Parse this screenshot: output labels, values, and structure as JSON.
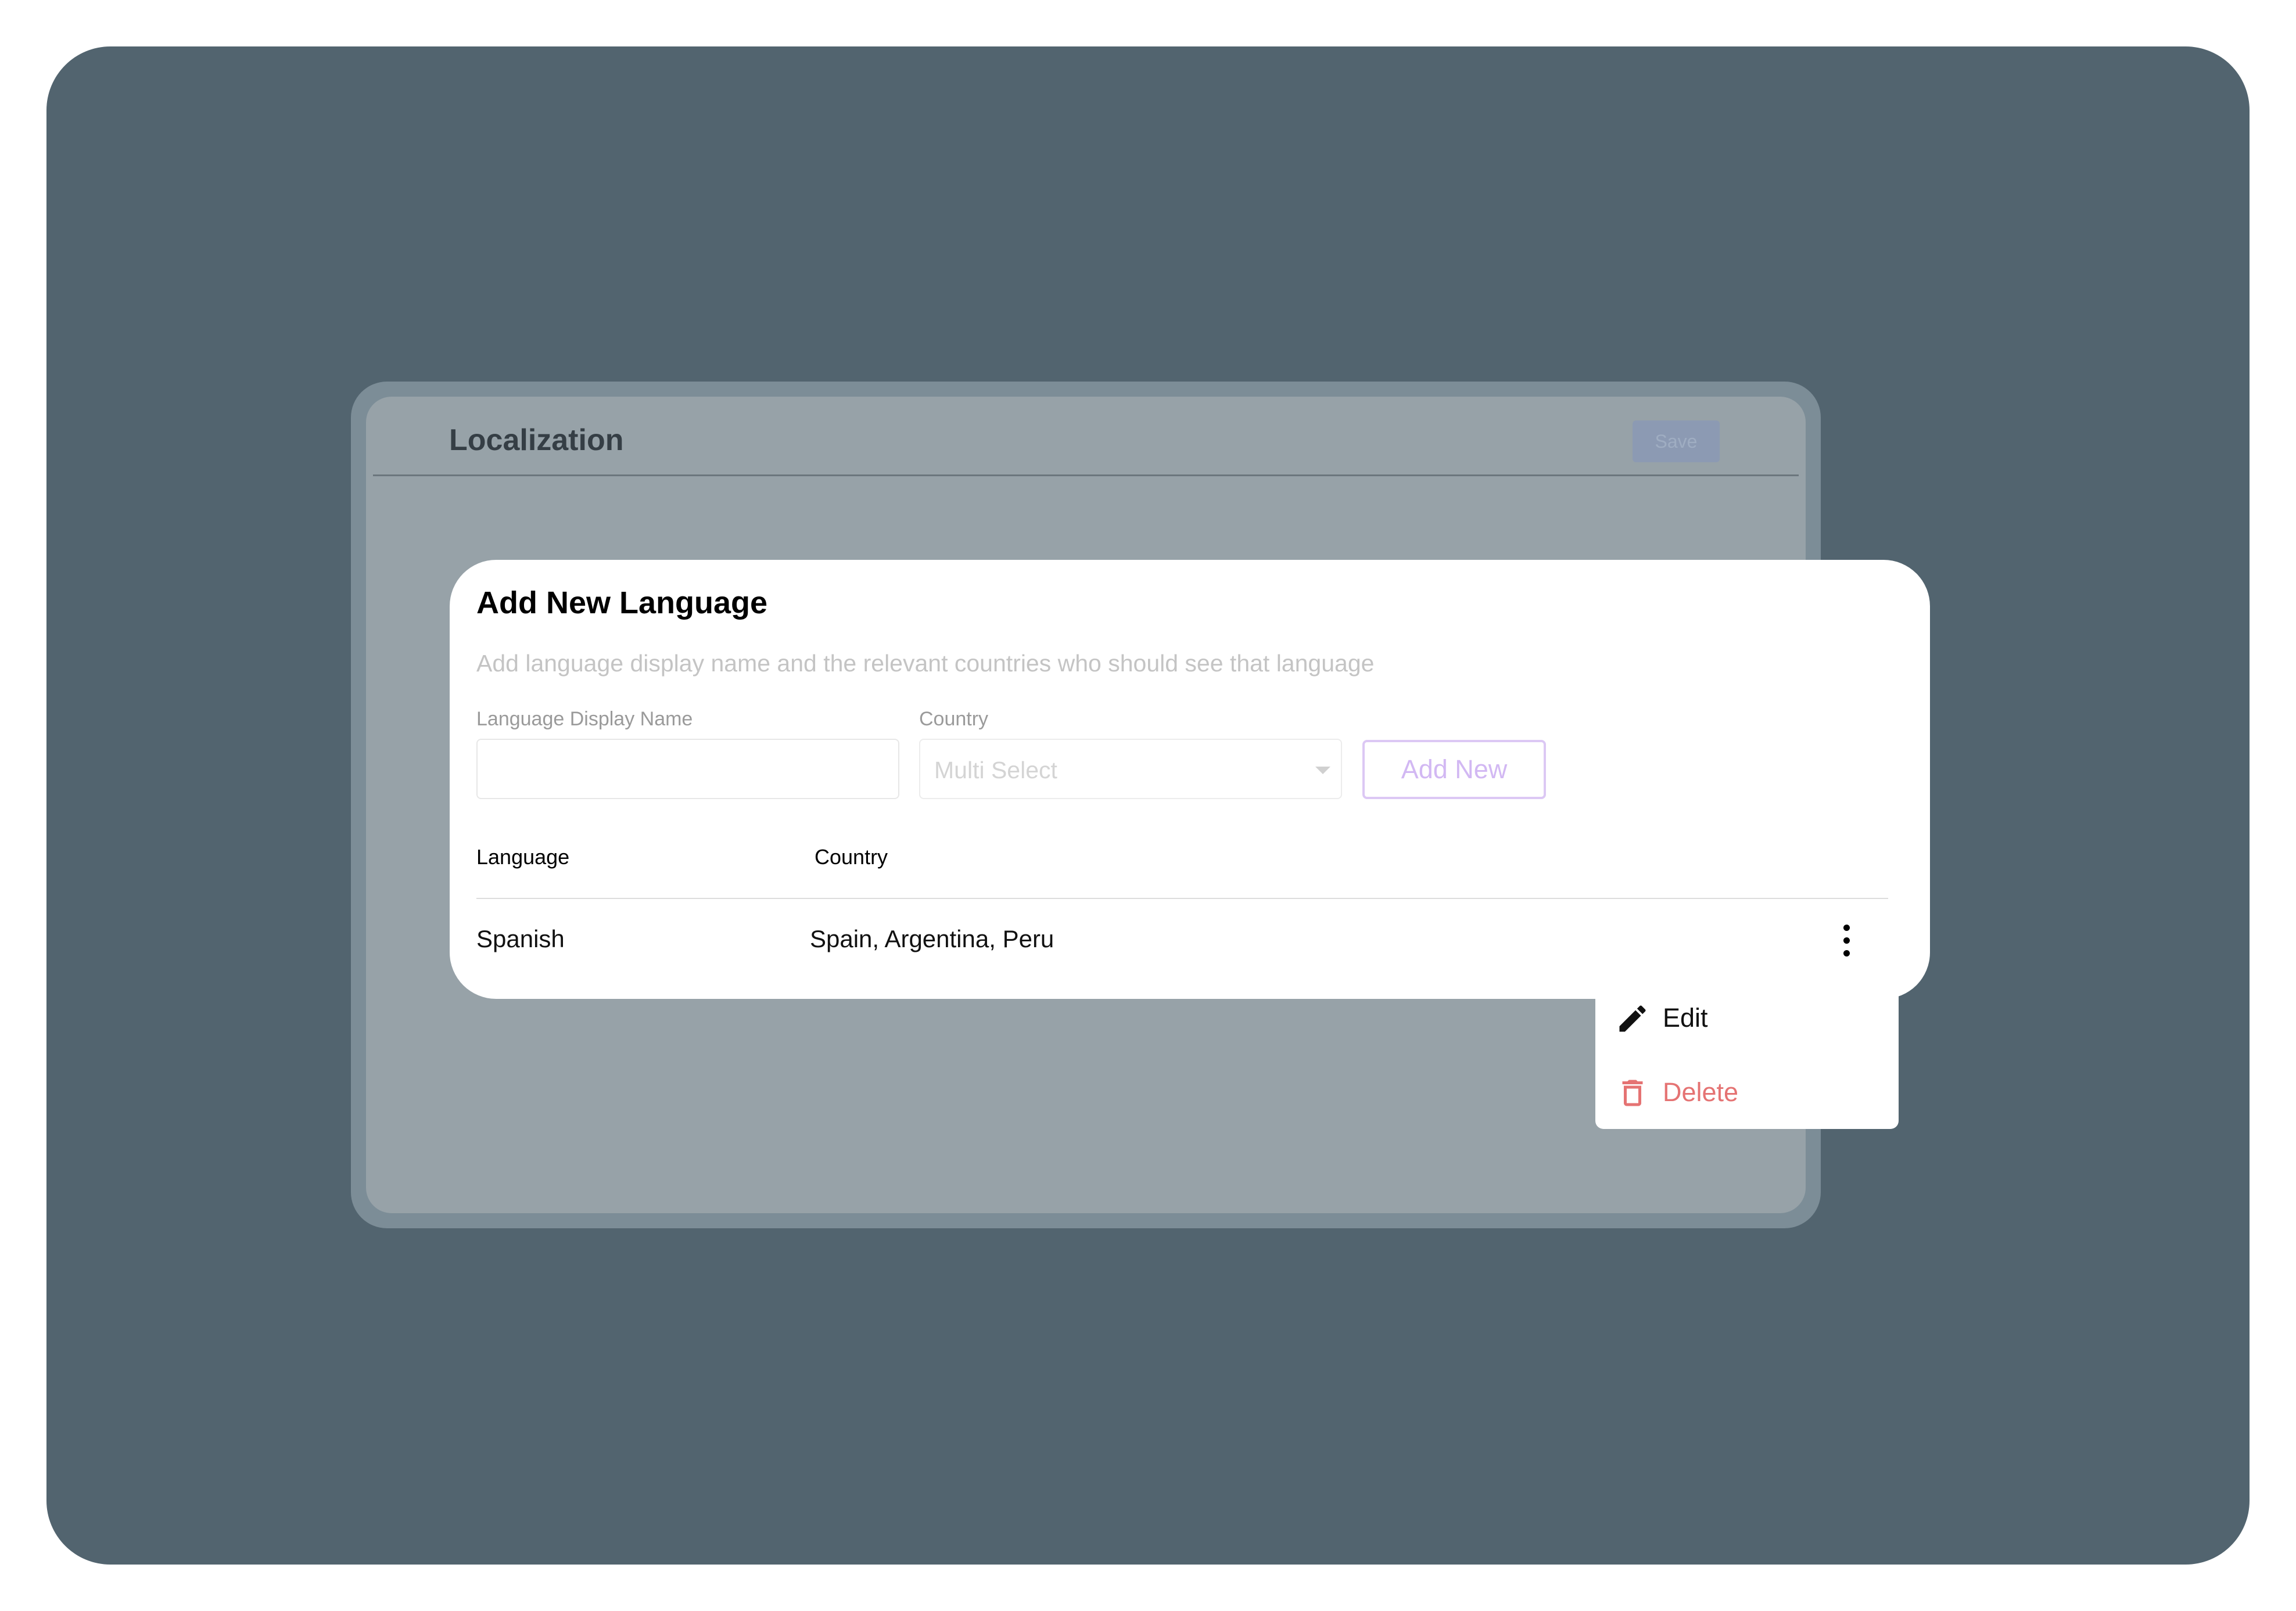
{
  "app": {
    "title": "Localization",
    "save_label": "Save"
  },
  "dialog": {
    "title": "Add New Language",
    "subtitle": "Add language display name and the relevant countries who should see that language",
    "form": {
      "language_label": "Language Display Name",
      "language_value": "",
      "country_label": "Country",
      "country_placeholder": "Multi Select",
      "add_button_label": "Add New"
    },
    "table": {
      "columns": [
        "Language",
        "Country"
      ],
      "rows": [
        {
          "language": "Spanish",
          "countries": "Spain, Argentina, Peru"
        }
      ]
    }
  },
  "context_menu": {
    "items": [
      {
        "label": "Edit",
        "icon": "pencil-icon"
      },
      {
        "label": "Delete",
        "icon": "trash-icon"
      }
    ]
  },
  "colors": {
    "backdrop": "#52646f",
    "accent_light": "#d2b8f3",
    "danger": "#e57373",
    "placeholder": "#d4d4d4"
  }
}
